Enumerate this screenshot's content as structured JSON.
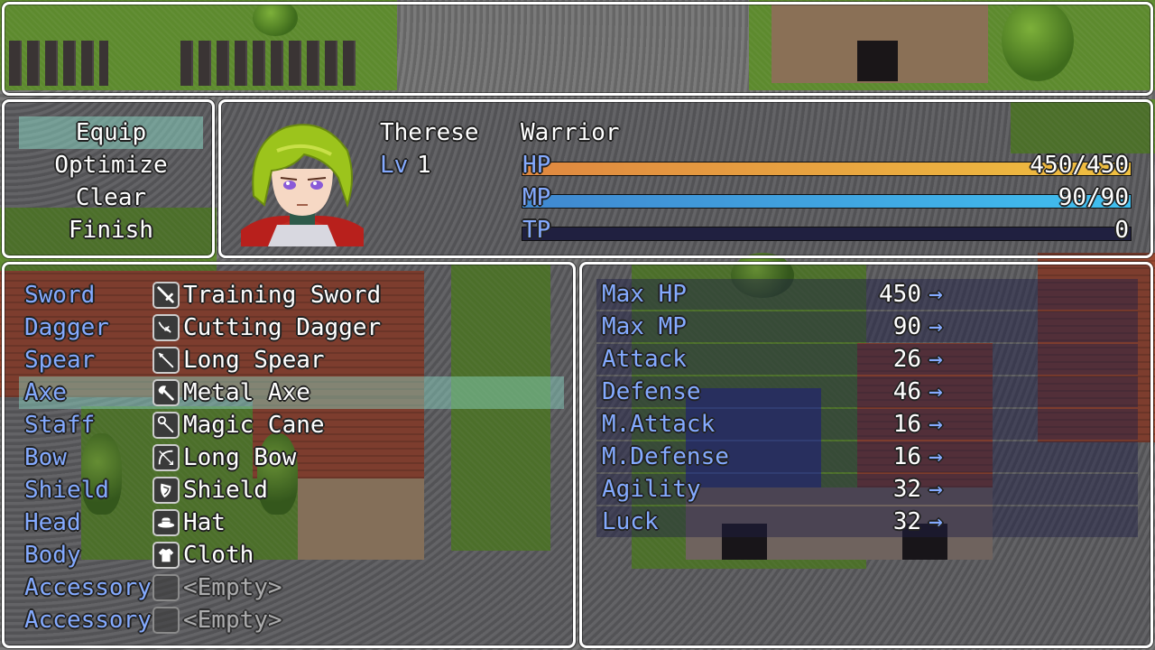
{
  "help": {
    "text": ""
  },
  "commands": [
    {
      "label": "Equip",
      "selected": true
    },
    {
      "label": "Optimize",
      "selected": false
    },
    {
      "label": "Clear",
      "selected": false
    },
    {
      "label": "Finish",
      "selected": false
    }
  ],
  "actor": {
    "name": "Therese",
    "class": "Warrior",
    "level_label": "Lv",
    "level": "1",
    "face": "green-haired-warrior-portrait",
    "hp": {
      "label": "HP",
      "value": "450/450",
      "ratio": 1.0,
      "colors": [
        "#e08840",
        "#f0c040"
      ]
    },
    "mp": {
      "label": "MP",
      "value": "90/90",
      "ratio": 1.0,
      "colors": [
        "#4088d0",
        "#40c0f0"
      ]
    },
    "tp": {
      "label": "TP",
      "value": "0",
      "ratio": 0.0,
      "colors": [
        "#30c060",
        "#a0f080"
      ]
    }
  },
  "slots": [
    {
      "type": "Sword",
      "icon": "sword-icon",
      "item": "Training Sword",
      "selected": false
    },
    {
      "type": "Dagger",
      "icon": "dagger-icon",
      "item": "Cutting Dagger",
      "selected": false
    },
    {
      "type": "Spear",
      "icon": "spear-icon",
      "item": "Long Spear",
      "selected": false
    },
    {
      "type": "Axe",
      "icon": "axe-icon",
      "item": "Metal Axe",
      "selected": true
    },
    {
      "type": "Staff",
      "icon": "staff-icon",
      "item": "Magic Cane",
      "selected": false
    },
    {
      "type": "Bow",
      "icon": "bow-icon",
      "item": "Long Bow",
      "selected": false
    },
    {
      "type": "Shield",
      "icon": "shield-icon",
      "item": "Shield",
      "selected": false
    },
    {
      "type": "Head",
      "icon": "hat-icon",
      "item": "Hat",
      "selected": false
    },
    {
      "type": "Body",
      "icon": "cloth-icon",
      "item": "Cloth",
      "selected": false
    },
    {
      "type": "Accessory",
      "icon": "empty-slot-icon",
      "item": "<Empty>",
      "selected": false
    },
    {
      "type": "Accessory",
      "icon": "empty-slot-icon",
      "item": "<Empty>",
      "selected": false
    }
  ],
  "params": [
    {
      "name": "Max HP",
      "value": "450",
      "arrow": "→"
    },
    {
      "name": "Max MP",
      "value": "90",
      "arrow": "→"
    },
    {
      "name": "Attack",
      "value": "26",
      "arrow": "→"
    },
    {
      "name": "Defense",
      "value": "46",
      "arrow": "→"
    },
    {
      "name": "M.Attack",
      "value": "16",
      "arrow": "→"
    },
    {
      "name": "M.Defense",
      "value": "16",
      "arrow": "→"
    },
    {
      "name": "Agility",
      "value": "32",
      "arrow": "→"
    },
    {
      "name": "Luck",
      "value": "32",
      "arrow": "→"
    }
  ],
  "colors": {
    "system_text": "#84aaff",
    "normal_text": "#ffffff",
    "cursor": "#8cdcc8",
    "tp_gauge_bg": "#202040"
  }
}
